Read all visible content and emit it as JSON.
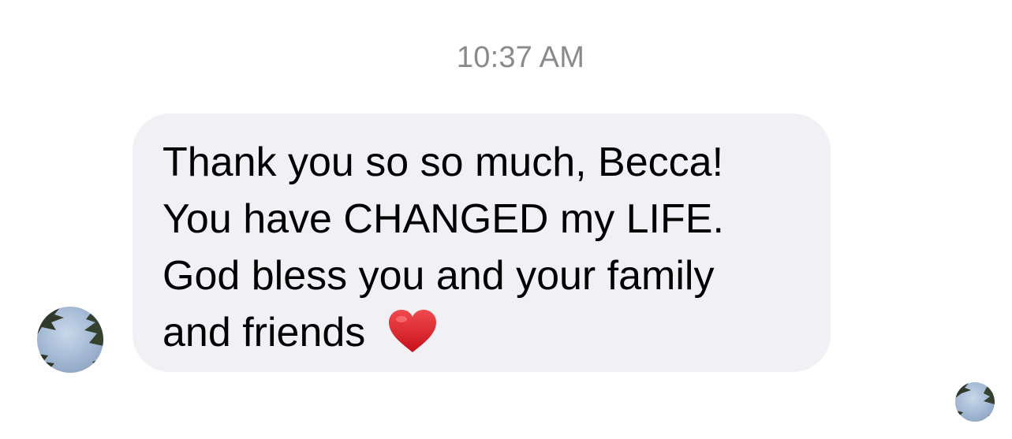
{
  "conversation": {
    "timestamp": "10:37 AM",
    "message": {
      "lines": [
        "Thank you so so much, Becca!",
        "You have CHANGED my LIFE.",
        "God bless you and your family",
        "and friends"
      ],
      "emoji": "red-heart"
    },
    "colors": {
      "bubble": "#f0f0f5",
      "timestamp": "#8a8a8e",
      "text": "#000000",
      "heart": "#e0202a"
    }
  }
}
